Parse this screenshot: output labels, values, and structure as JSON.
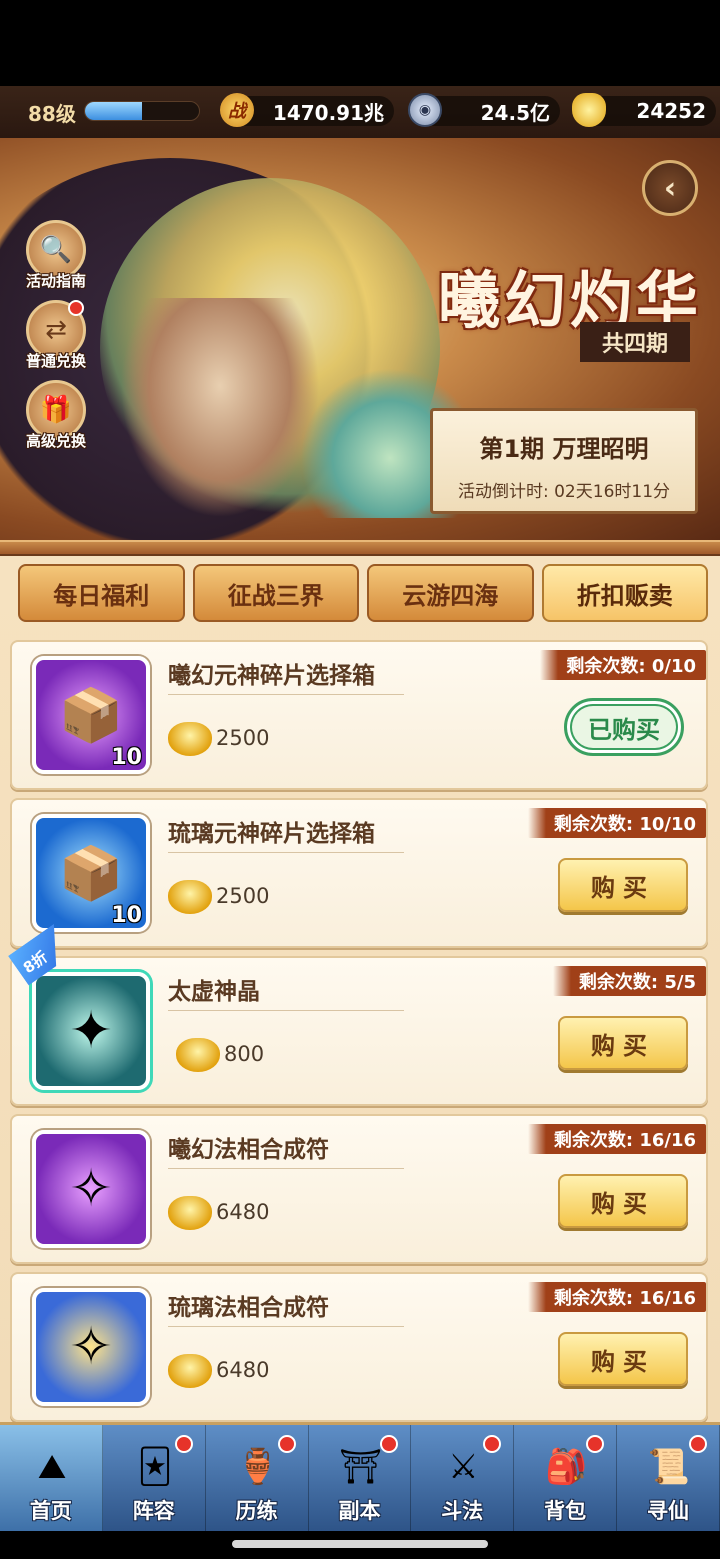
{
  "status": {
    "level": "88级",
    "exp_fraction": 0.5,
    "power_icon": "战",
    "power": "1470.91兆",
    "silver": "24.5亿",
    "gold": "24252"
  },
  "banner": {
    "title": "曦幻灼华",
    "subtitle": "共四期",
    "period_name": "第1期  万理昭明",
    "countdown": "活动倒计时: 02天16时11分",
    "side_buttons": [
      {
        "label": "活动指南",
        "icon": "magnifier-icon",
        "has_dot": false
      },
      {
        "label": "普通兑换",
        "icon": "exchange-icon",
        "has_dot": true
      },
      {
        "label": "高级兑换",
        "icon": "gift-icon",
        "has_dot": false
      }
    ]
  },
  "tabs": [
    "每日福利",
    "征战三界",
    "云游四海",
    "折扣贩卖"
  ],
  "active_tab": 3,
  "items": [
    {
      "name": "曦幻元神碎片选择箱",
      "price": "2500",
      "remain": "剩余次数: 0/10",
      "count": "10",
      "status": "已购买",
      "color": "purple"
    },
    {
      "name": "琉璃元神碎片选择箱",
      "price": "2500",
      "remain": "剩余次数: 10/10",
      "count": "10",
      "status": "购买",
      "color": "blue"
    },
    {
      "name": "太虚神晶",
      "price": "800",
      "remain": "剩余次数: 5/5",
      "count": "",
      "status": "购买",
      "color": "teal",
      "discount": "8折"
    },
    {
      "name": "曦幻法相合成符",
      "price": "6480",
      "remain": "剩余次数: 16/16",
      "count": "",
      "status": "购买",
      "color": "purple"
    },
    {
      "name": "琉璃法相合成符",
      "price": "6480",
      "remain": "剩余次数: 16/16",
      "count": "",
      "status": "购买",
      "color": "gold"
    }
  ],
  "buy_label": "购买",
  "nav": [
    {
      "label": "首页",
      "icon": "home-icon",
      "dot": false
    },
    {
      "label": "阵容",
      "icon": "lineup-icon",
      "dot": true
    },
    {
      "label": "历练",
      "icon": "training-icon",
      "dot": true
    },
    {
      "label": "副本",
      "icon": "dungeon-icon",
      "dot": true
    },
    {
      "label": "斗法",
      "icon": "battle-icon",
      "dot": true
    },
    {
      "label": "背包",
      "icon": "bag-icon",
      "dot": true
    },
    {
      "label": "寻仙",
      "icon": "seek-icon",
      "dot": true
    }
  ]
}
